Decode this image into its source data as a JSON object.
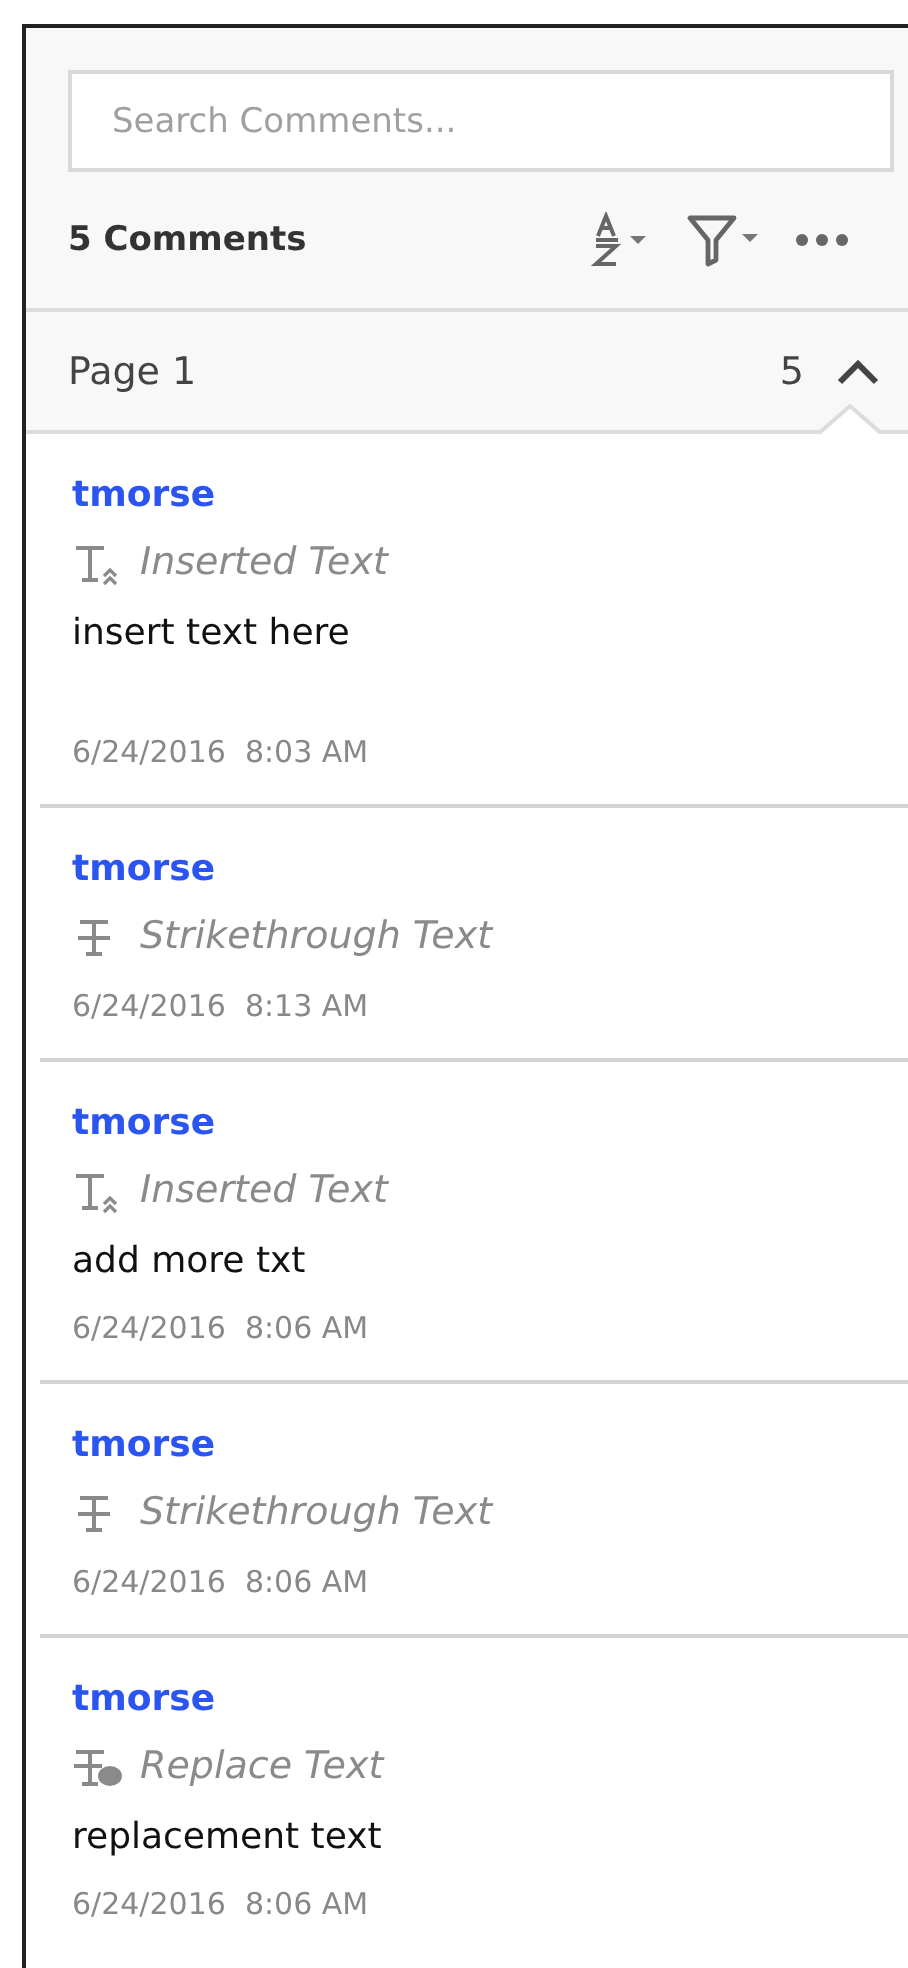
{
  "search": {
    "placeholder": "Search Comments..."
  },
  "toolbar": {
    "count_label": "5 Comments"
  },
  "page_group": {
    "label": "Page 1",
    "count": "5",
    "expanded": true
  },
  "comments": [
    {
      "author": "tmorse",
      "kind": "insert",
      "type_label": "Inserted Text",
      "note": "insert text here",
      "date": "6/24/2016  8:03 AM"
    },
    {
      "author": "tmorse",
      "kind": "strikethrough",
      "type_label": "Strikethrough Text",
      "date": "6/24/2016  8:13 AM"
    },
    {
      "author": "tmorse",
      "kind": "insert",
      "type_label": "Inserted Text",
      "note": "add more txt",
      "date": "6/24/2016  8:06 AM"
    },
    {
      "author": "tmorse",
      "kind": "strikethrough",
      "type_label": "Strikethrough Text",
      "date": "6/24/2016  8:06 AM"
    },
    {
      "author": "tmorse",
      "kind": "replace",
      "type_label": "Replace Text",
      "note": "replacement text",
      "date": "6/24/2016  8:06 AM"
    }
  ]
}
